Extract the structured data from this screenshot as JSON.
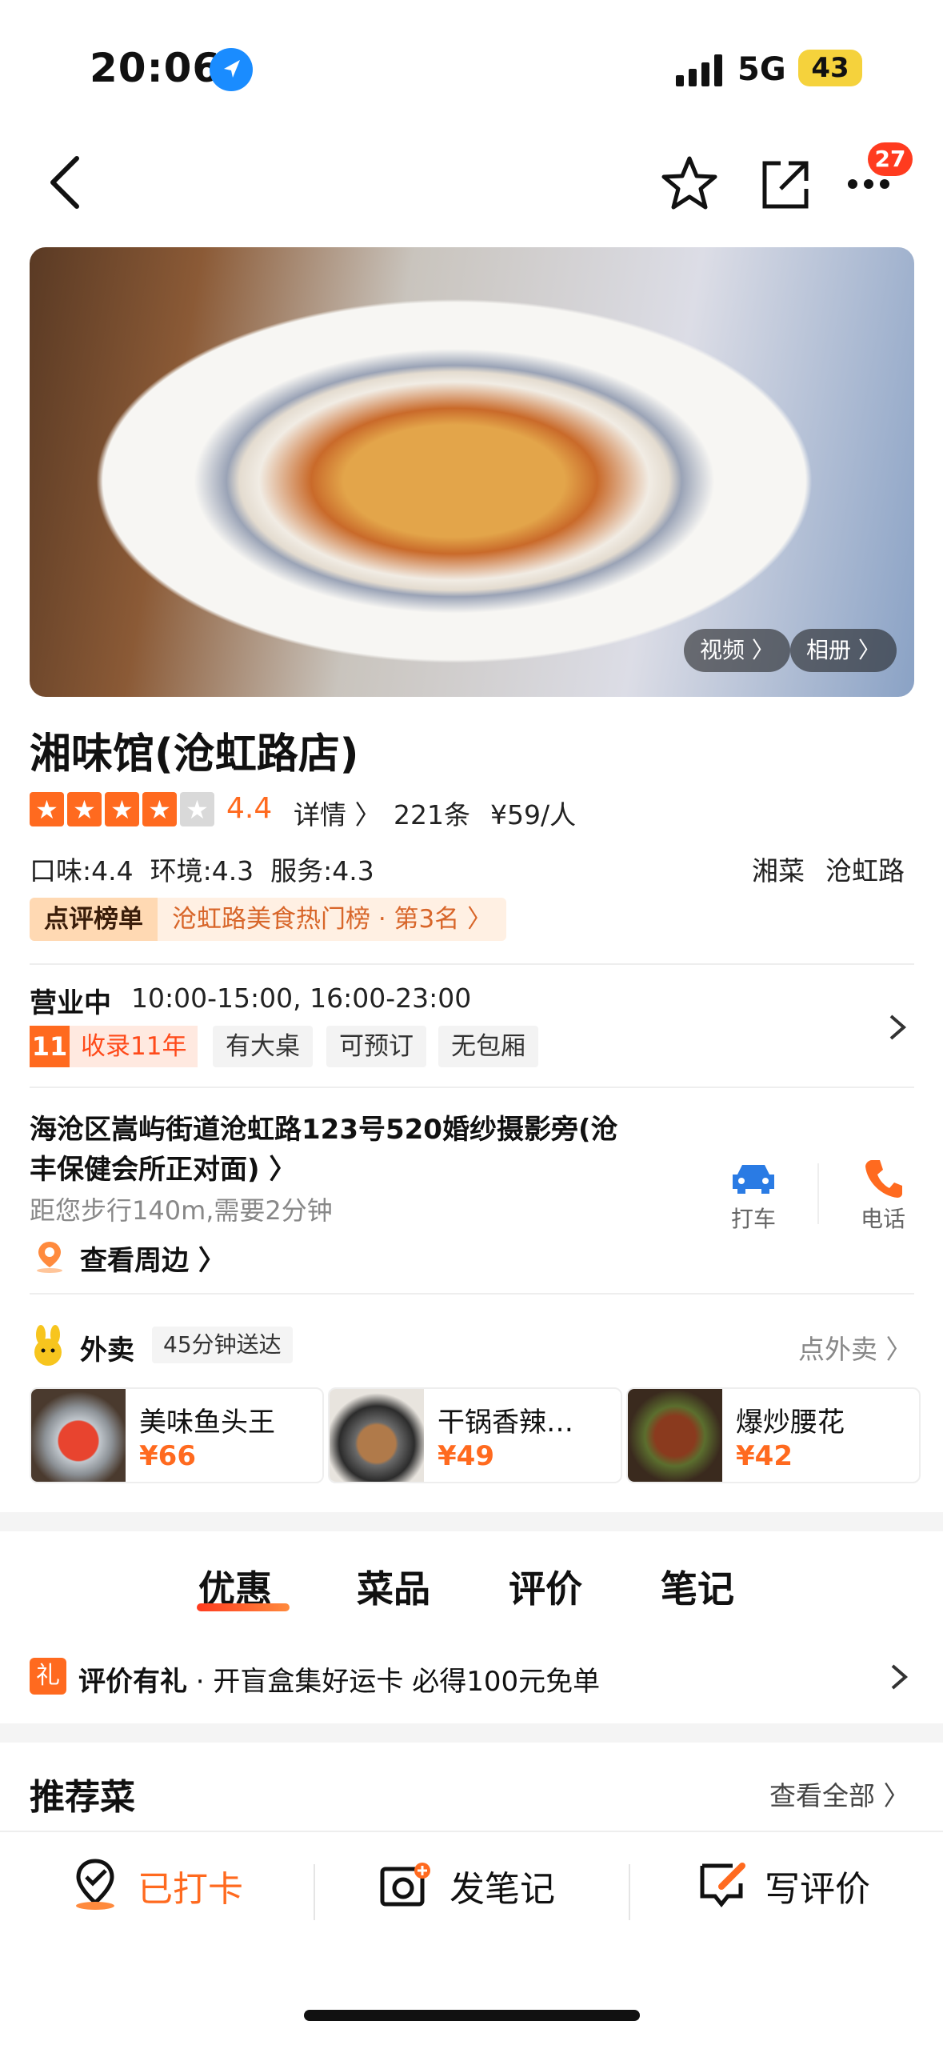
{
  "status": {
    "time": "20:06",
    "network": "5G",
    "battery": "43"
  },
  "nav": {
    "badge_count": "27"
  },
  "hero": {
    "video_label": "视频 〉",
    "album_label": "相册 〉"
  },
  "shop": {
    "name": "湘味馆(沧虹路店)",
    "rating": "4.4",
    "stars": 4,
    "details_label": "详情 〉",
    "review_count": "221条",
    "price_per_person": "¥59/人",
    "sub_scores": "口味:4.4  环境:4.3  服务:4.3",
    "cuisine": "湘菜",
    "area": "沧虹路",
    "rank_badge": "点评榜单",
    "rank_text": "沧虹路美食热门榜 · 第3名 〉"
  },
  "hours": {
    "status": "营业中",
    "times": "10:00-15:00, 16:00-23:00",
    "years_icon": "11",
    "years_label": "收录11年",
    "tags": [
      "有大桌",
      "可预订",
      "无包厢"
    ]
  },
  "address": {
    "line1": "海沧区嵩屿街道沧虹路123号520婚纱摄影旁(沧",
    "line2": "丰保健会所正对面) 〉",
    "distance": "距您步行140m,需要2分钟",
    "nearby": "查看周边 〉",
    "taxi_label": "打车",
    "phone_label": "电话"
  },
  "delivery": {
    "title": "外卖",
    "time_chip": "45分钟送达",
    "link": "点外卖 〉",
    "items": [
      {
        "name": "美味鱼头王",
        "price": "¥66"
      },
      {
        "name": "干锅香辣…",
        "price": "¥49"
      },
      {
        "name": "爆炒腰花",
        "price": "¥42"
      }
    ]
  },
  "tabs": [
    "优惠",
    "菜品",
    "评价",
    "笔记"
  ],
  "promo": {
    "icon": "礼",
    "bold": "评价有礼",
    "text": " · 开盲盒集好运卡 必得100元免单"
  },
  "recommend": {
    "title": "推荐菜",
    "view_all": "查看全部 〉"
  },
  "bottom": {
    "checkin": "已打卡",
    "note": "发笔记",
    "review": "写评价"
  }
}
